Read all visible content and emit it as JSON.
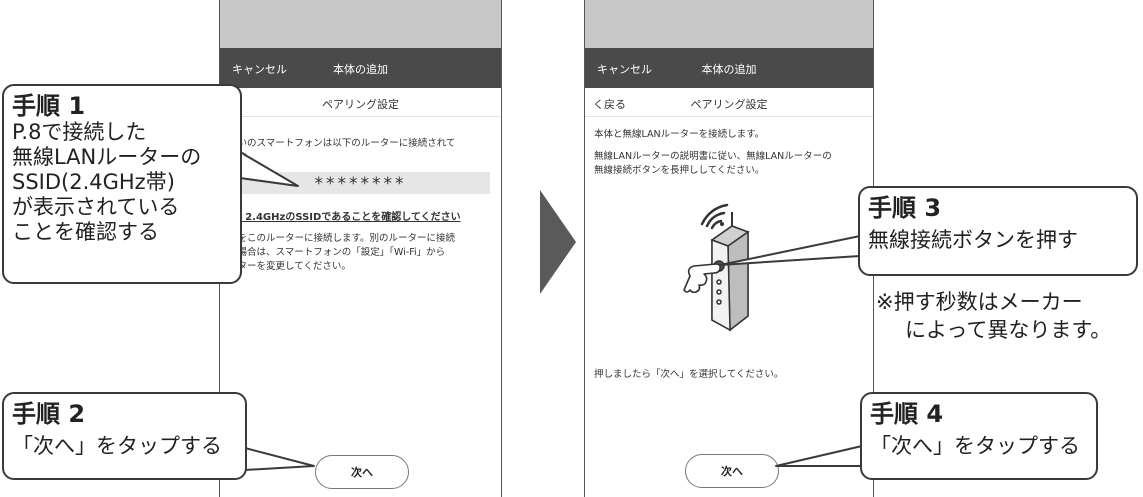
{
  "screen1": {
    "header_left": "キャンセル",
    "header_title": "本体の追加",
    "sub_title": "ペアリング設定",
    "body_line1": "使いのスマートフォンは以下のルーターに接続されて",
    "body_line2": "ます。",
    "ssid_masked": "********",
    "confirm_text": "※ 2.4GHzのSSIDであることを確認してください",
    "body2_line1": "本をこのルーターに接続します。別のルーターに接続",
    "body2_line2": "る場合は、スマートフォンの「設定」「Wi-Fi」から",
    "body2_line3": "ーターを変更してください。",
    "next_label": "次へ"
  },
  "screen2": {
    "header_left": "キャンセル",
    "header_title": "本体の追加",
    "back_label": "く戻る",
    "sub_title": "ペアリング設定",
    "body_line1": "本体と無線LANルーターを接続します。",
    "body_line2": "無線LANルーターの説明書に従い、無線LANルーターの",
    "body_line3": "無線接続ボタンを長押ししてください。",
    "after_text": "押しましたら「次へ」を選択してください。",
    "next_label": "次へ"
  },
  "callouts": {
    "step1_title": "手順 1",
    "step1_lines": [
      "P.8で接続した",
      "無線LANルーターの",
      "SSID(2.4GHz帯)",
      "が表示されている",
      "ことを確認する"
    ],
    "step2_title": "手順 2",
    "step2_body": "「次へ」をタップする",
    "step3_title": "手順 3",
    "step3_body": "無線接続ボタンを押す",
    "step3_note_line1": "※押す秒数はメーカー",
    "step3_note_line2": "によって異なります。",
    "step4_title": "手順 4",
    "step4_body": "「次へ」をタップする"
  },
  "colors": {
    "header_bg": "#4a4a4a",
    "status_bg": "#c8c8c8",
    "arrow": "#5a5a5a"
  }
}
